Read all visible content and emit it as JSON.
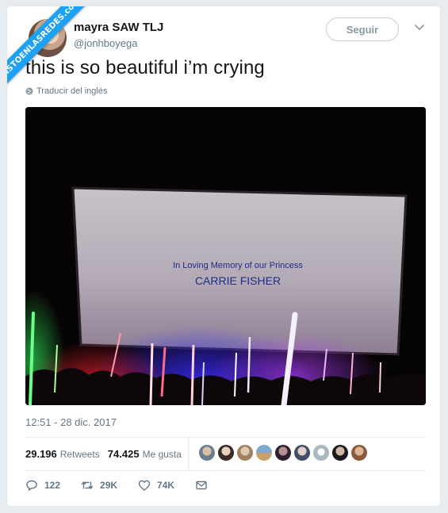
{
  "watermark": {
    "text": "VISTOENLASREDES.com"
  },
  "author": {
    "display_name": "mayra SAW TLJ",
    "handle": "@jonhboyega"
  },
  "follow_button": {
    "label": "Seguir"
  },
  "tweet": {
    "text": "this is so beautiful i’m crying",
    "translate_label": "Traducir del inglés"
  },
  "media": {
    "screen_line1": "In Loving Memory of our Princess",
    "screen_line2": "CARRIE FISHER"
  },
  "timestamp": "12:51 - 28 dic. 2017",
  "stats": {
    "retweets_count": "29.196",
    "retweets_label": "Retweets",
    "likes_count": "74.425",
    "likes_label": "Me gusta"
  },
  "likers_count_shown": 9,
  "actions": {
    "reply_count": "122",
    "retweet_count": "29K",
    "like_count": "74K"
  },
  "icons": [
    "globe-icon",
    "chevron-down-icon",
    "reply-icon",
    "retweet-icon",
    "like-icon",
    "message-icon"
  ],
  "colors": {
    "twitter_blue": "#1da1f2",
    "text": "#14171a",
    "secondary": "#657786"
  }
}
